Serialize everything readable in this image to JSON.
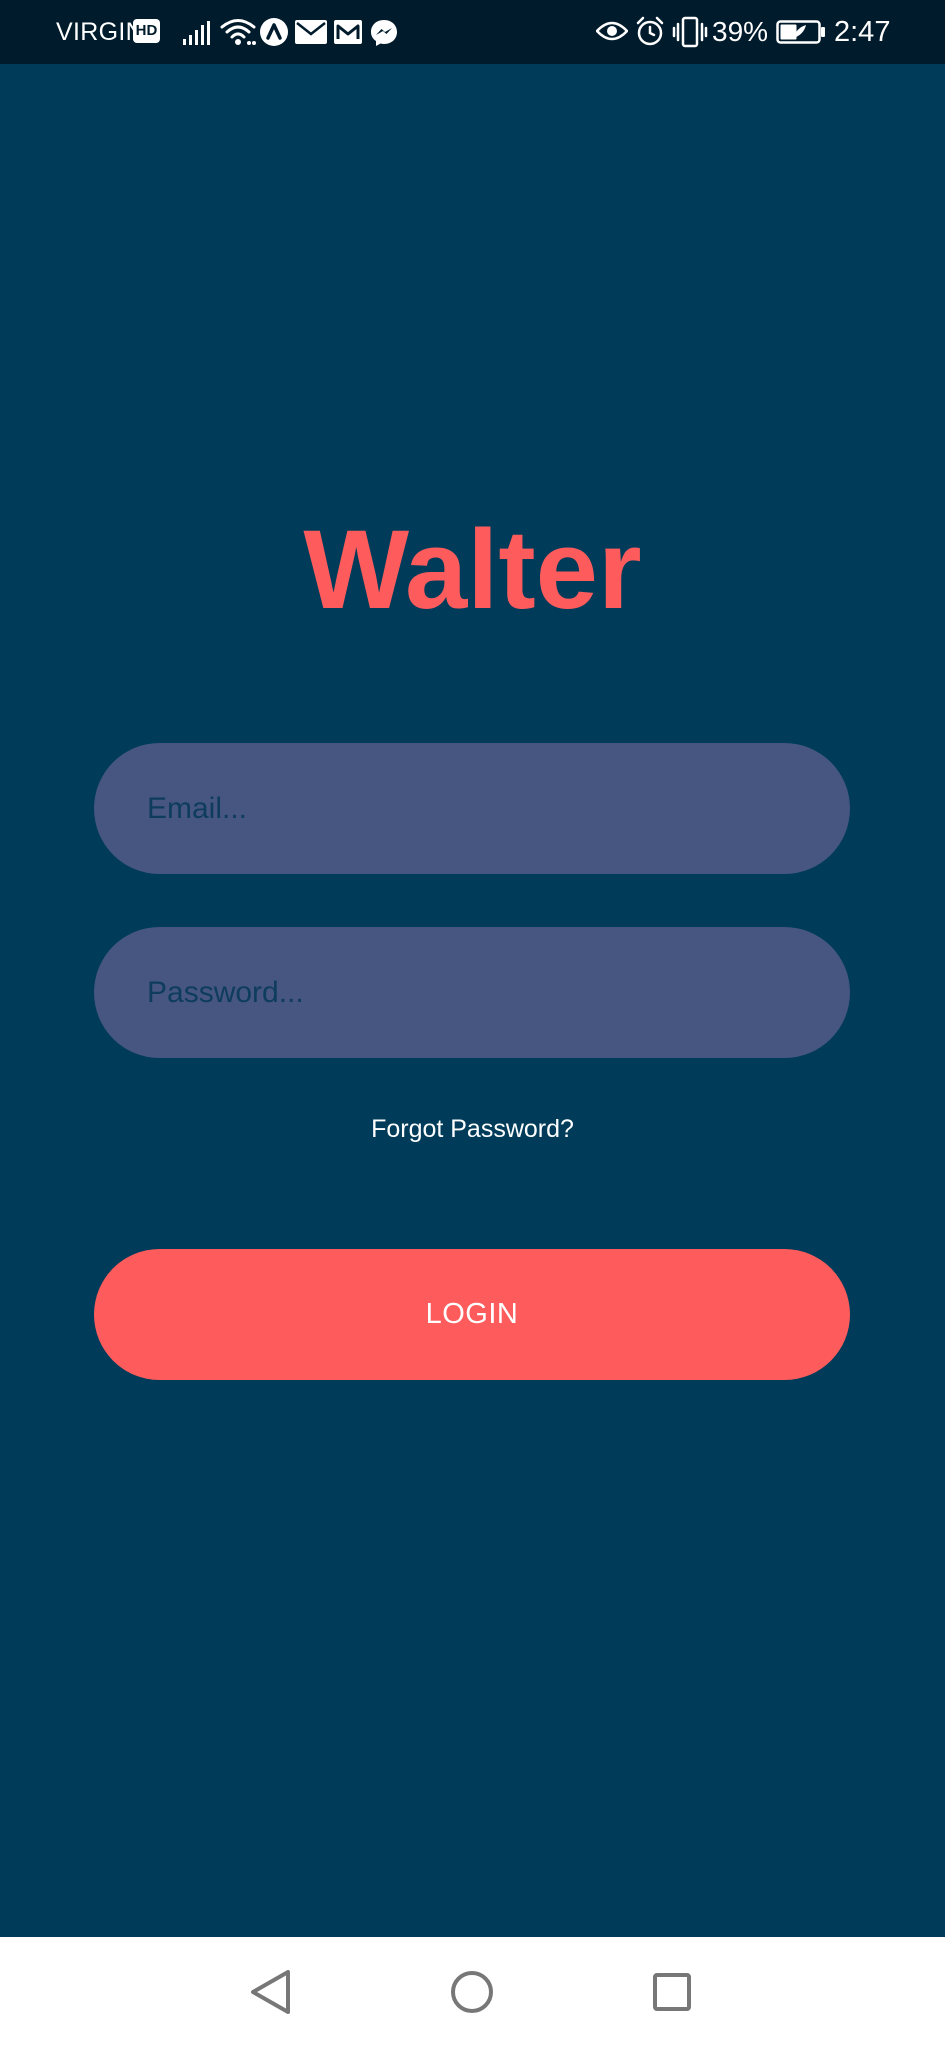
{
  "status_bar": {
    "carrier": "VIRGIN",
    "network_badge": "HD",
    "icons": [
      "signal-icon",
      "wifi-icon",
      "app-notification-icon",
      "mail-icon",
      "gmail-icon",
      "messenger-icon",
      "eye-icon",
      "alarm-icon",
      "vibrate-icon",
      "battery-icon"
    ],
    "battery_percent": "39%",
    "time": "2:47"
  },
  "login": {
    "app_title": "Walter",
    "email_placeholder": "Email...",
    "password_placeholder": "Password...",
    "forgot_password": "Forgot Password?",
    "login_label": "LOGIN"
  },
  "nav_bar": {
    "buttons": [
      "back-icon",
      "home-icon",
      "recents-icon"
    ]
  },
  "colors": {
    "background": "#003c5a",
    "status_bar": "#001b2b",
    "accent": "#fe5b5c",
    "input_fill": "#465680",
    "placeholder": "#0e3c5c",
    "nav_bar": "#ffffff"
  }
}
